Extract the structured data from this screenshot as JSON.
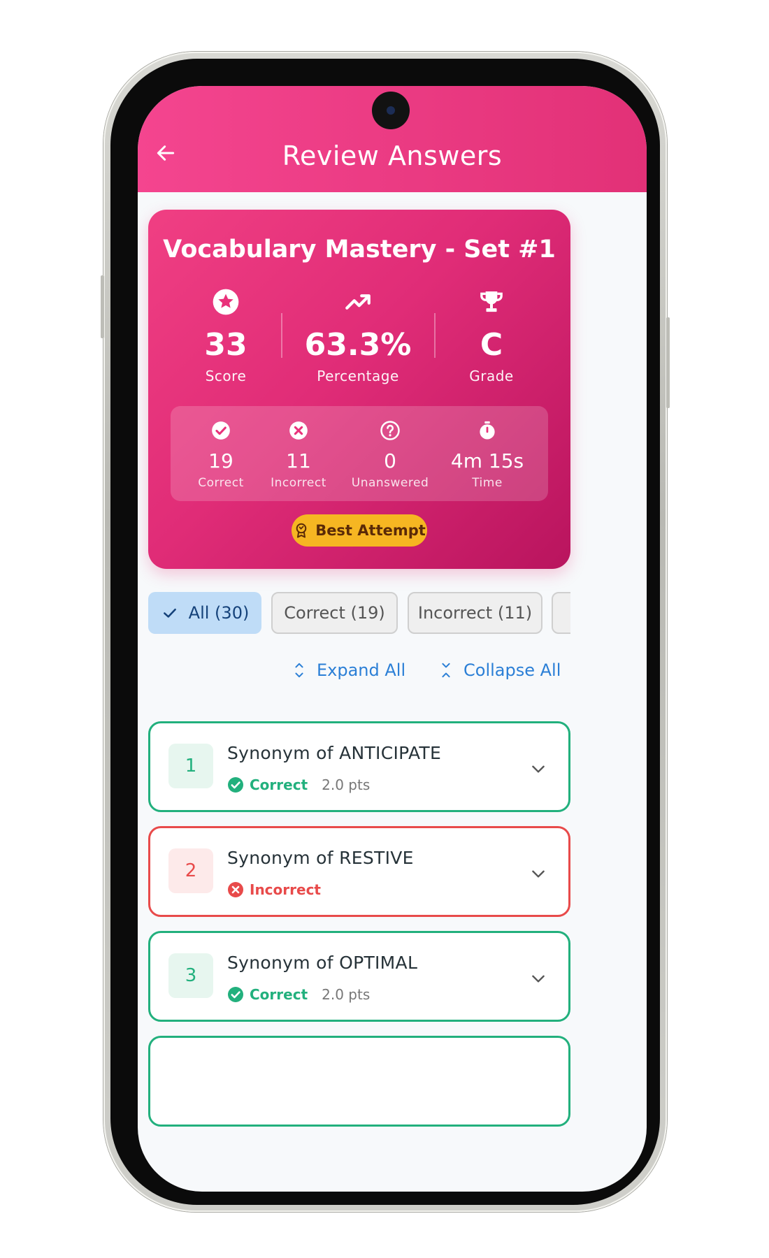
{
  "header": {
    "title": "Review Answers"
  },
  "summary": {
    "title": "Vocabulary Mastery - Set #1",
    "stats": [
      {
        "value": "33",
        "label": "Score",
        "icon": "star-circle-icon"
      },
      {
        "value": "63.3%",
        "label": "Percentage",
        "icon": "trending-up-icon"
      },
      {
        "value": "C",
        "label": "Grade",
        "icon": "trophy-icon"
      }
    ],
    "substats": [
      {
        "value": "19",
        "label": "Correct",
        "icon": "check-circle-icon"
      },
      {
        "value": "11",
        "label": "Incorrect",
        "icon": "x-circle-icon"
      },
      {
        "value": "0",
        "label": "Unanswered",
        "icon": "help-circle-icon"
      },
      {
        "value": "4m 15s",
        "label": "Time",
        "icon": "stopwatch-icon"
      }
    ],
    "badge": "Best Attempt"
  },
  "filters": [
    {
      "label": "All (30)",
      "active": true
    },
    {
      "label": "Correct (19)",
      "active": false
    },
    {
      "label": "Incorrect (11)",
      "active": false
    }
  ],
  "actions": {
    "expand": "Expand All",
    "collapse": "Collapse All"
  },
  "questions": [
    {
      "number": "1",
      "title": "Synonym of ANTICIPATE",
      "status": "Correct",
      "points": "2.0 pts"
    },
    {
      "number": "2",
      "title": "Synonym of RESTIVE",
      "status": "Incorrect",
      "points": ""
    },
    {
      "number": "3",
      "title": "Synonym of OPTIMAL",
      "status": "Correct",
      "points": "2.0 pts"
    }
  ],
  "colors": {
    "primary": "#e9317a",
    "correct": "#22b07d",
    "incorrect": "#e84a4a",
    "badge": "#f6b622",
    "link": "#2b7fd6",
    "active_chip": "#bfdcf7"
  }
}
